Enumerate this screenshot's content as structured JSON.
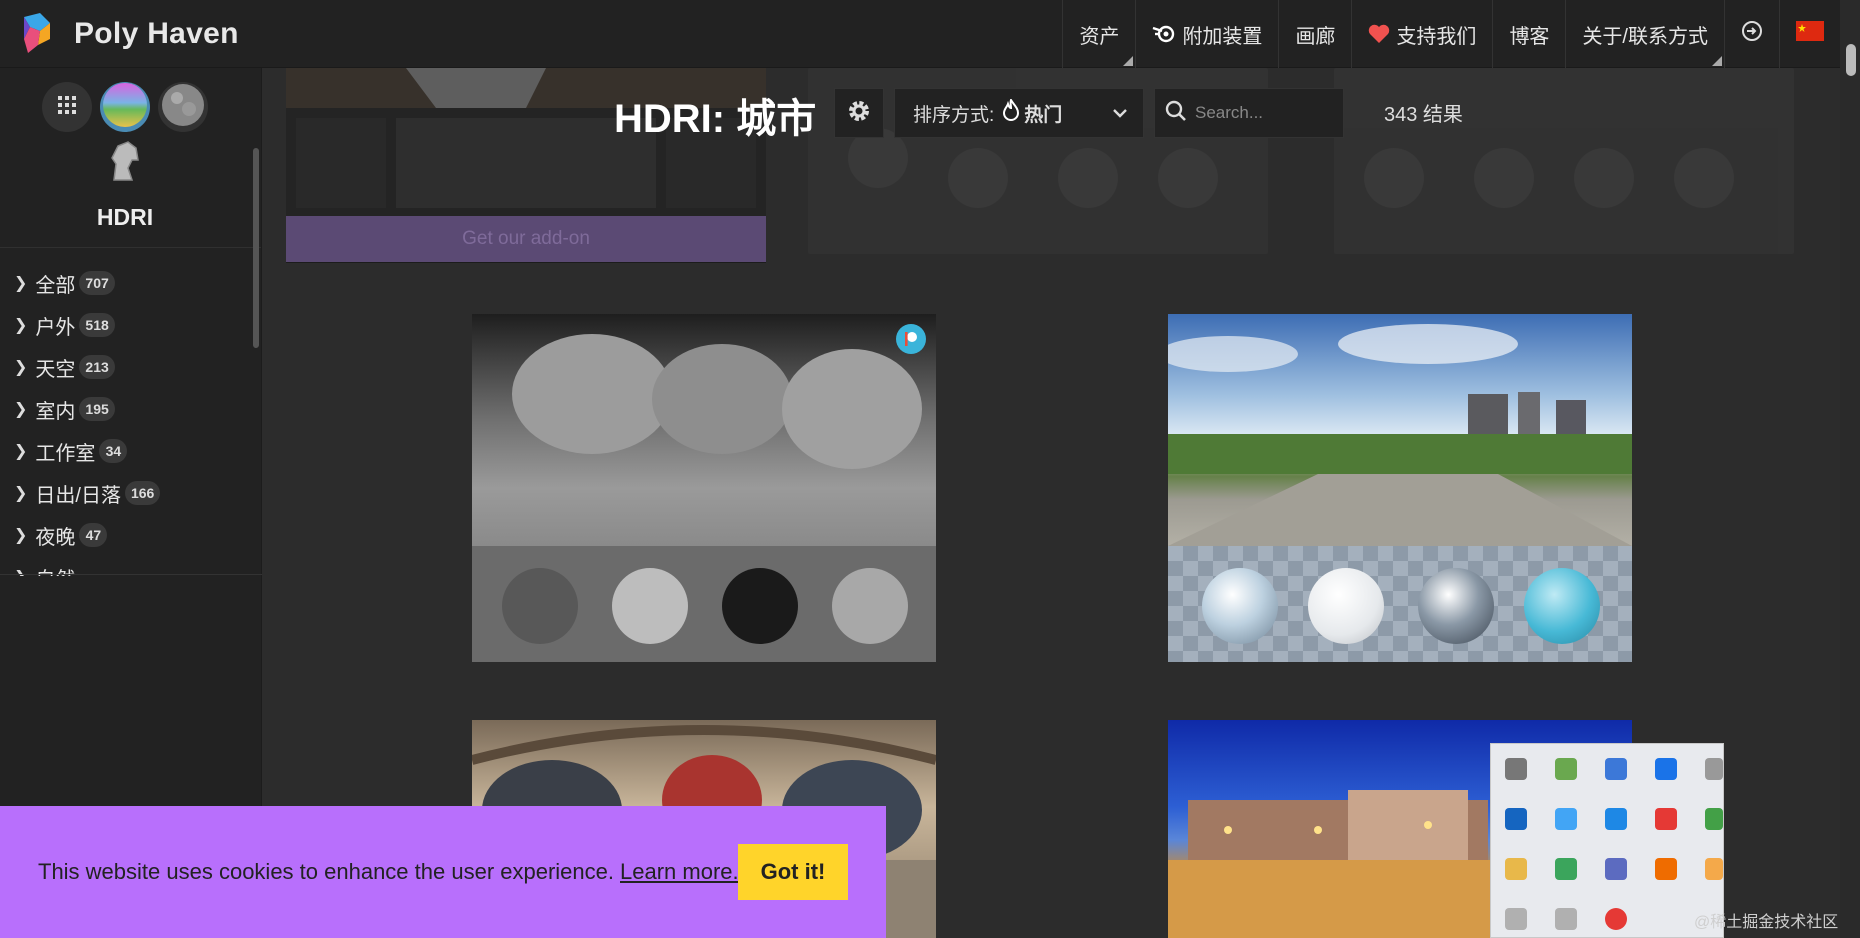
{
  "app": {
    "name": "Poly Haven"
  },
  "nav": {
    "items": [
      {
        "label": "资产",
        "icon": "none"
      },
      {
        "label": "附加装置",
        "icon": "blender-icon"
      },
      {
        "label": "画廊",
        "icon": "none"
      },
      {
        "label": "支持我们",
        "icon": "heart-icon"
      },
      {
        "label": "博客",
        "icon": "none"
      },
      {
        "label": "关于/联系方式",
        "icon": "none"
      }
    ],
    "login_icon": "login-icon",
    "language": "china-flag-icon"
  },
  "sidebar": {
    "asset_type": "HDRI",
    "categories": [
      {
        "label": "全部",
        "count": "707"
      },
      {
        "label": "户外",
        "count": "518"
      },
      {
        "label": "天空",
        "count": "213"
      },
      {
        "label": "室内",
        "count": "195"
      },
      {
        "label": "工作室",
        "count": "34"
      },
      {
        "label": "日出/日落",
        "count": "166"
      },
      {
        "label": "夜晚",
        "count": "47"
      },
      {
        "label": "自然",
        "count": ""
      }
    ]
  },
  "addon": {
    "button_label": "Get our add-on"
  },
  "toolbar": {
    "title": "HDRI: 城市",
    "sort_label": "排序方式:",
    "sort_value": "热门",
    "search_placeholder": "Search...",
    "results": "343 结果"
  },
  "cookie": {
    "text": "This website uses cookies to enhance the user experience.",
    "link": "Learn more.",
    "button": "Got it!"
  },
  "watermark": "@稀土掘金技术社区",
  "colors": {
    "accent_purple": "#b86ffc",
    "cookie_button": "#ffd42a",
    "patreon": "#3ab4da"
  }
}
